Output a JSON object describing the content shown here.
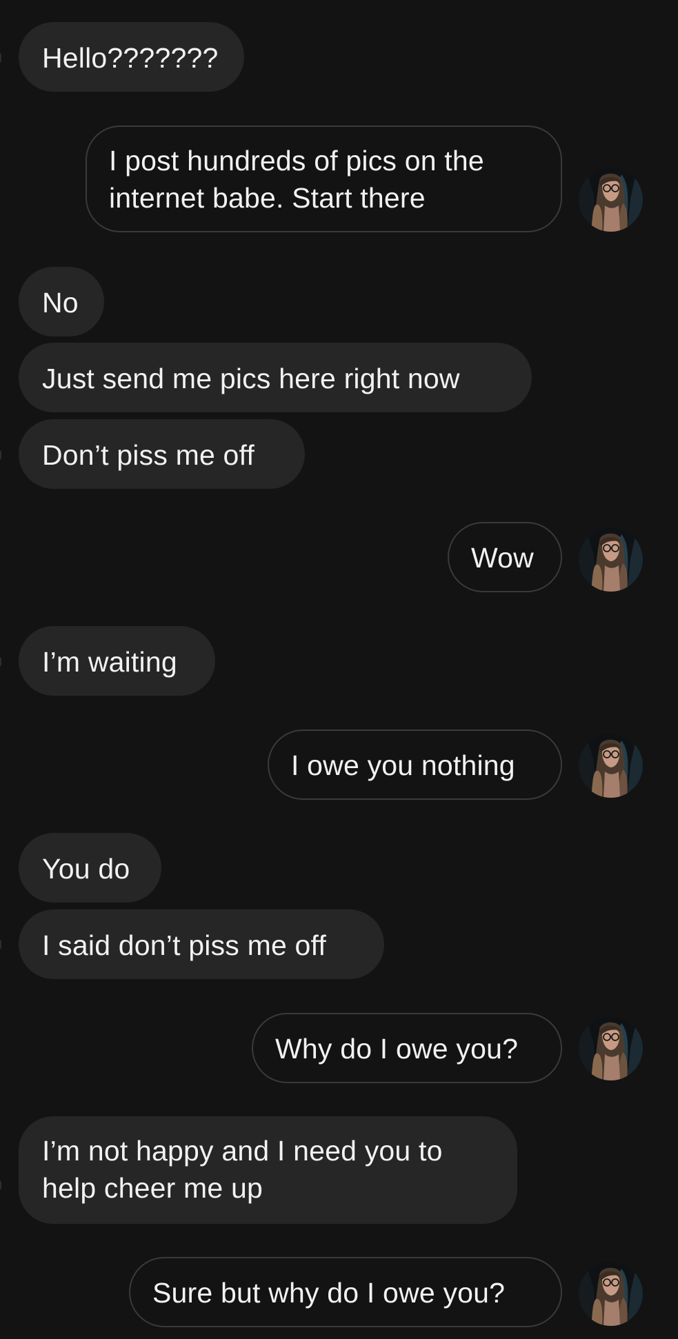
{
  "colors": {
    "background": "#131314",
    "incoming_bubble": "#262627",
    "outgoing_border": "#3a3a3c",
    "text": "#f2f2f2"
  },
  "conversation": {
    "messages": [
      {
        "direction": "incoming",
        "text": "Hello???????"
      },
      {
        "direction": "outgoing",
        "text": "I post hundreds of pics on the\ninternet babe. Start there",
        "avatar": "profile-photo"
      },
      {
        "direction": "incoming",
        "text": "No"
      },
      {
        "direction": "incoming",
        "text": "Just send me pics here right now"
      },
      {
        "direction": "incoming",
        "text": "Don’t piss me off"
      },
      {
        "direction": "outgoing",
        "text": "Wow",
        "avatar": "profile-photo"
      },
      {
        "direction": "incoming",
        "text": "I’m waiting"
      },
      {
        "direction": "outgoing",
        "text": "I owe you nothing",
        "avatar": "profile-photo"
      },
      {
        "direction": "incoming",
        "text": "You do"
      },
      {
        "direction": "incoming",
        "text": "I said don’t piss me off"
      },
      {
        "direction": "outgoing",
        "text": "Why do I owe you?",
        "avatar": "profile-photo"
      },
      {
        "direction": "incoming",
        "text": "I’m not happy and I need you to\nhelp cheer me up"
      },
      {
        "direction": "outgoing",
        "text": "Sure but why do I owe you?",
        "avatar": "profile-photo"
      }
    ]
  }
}
